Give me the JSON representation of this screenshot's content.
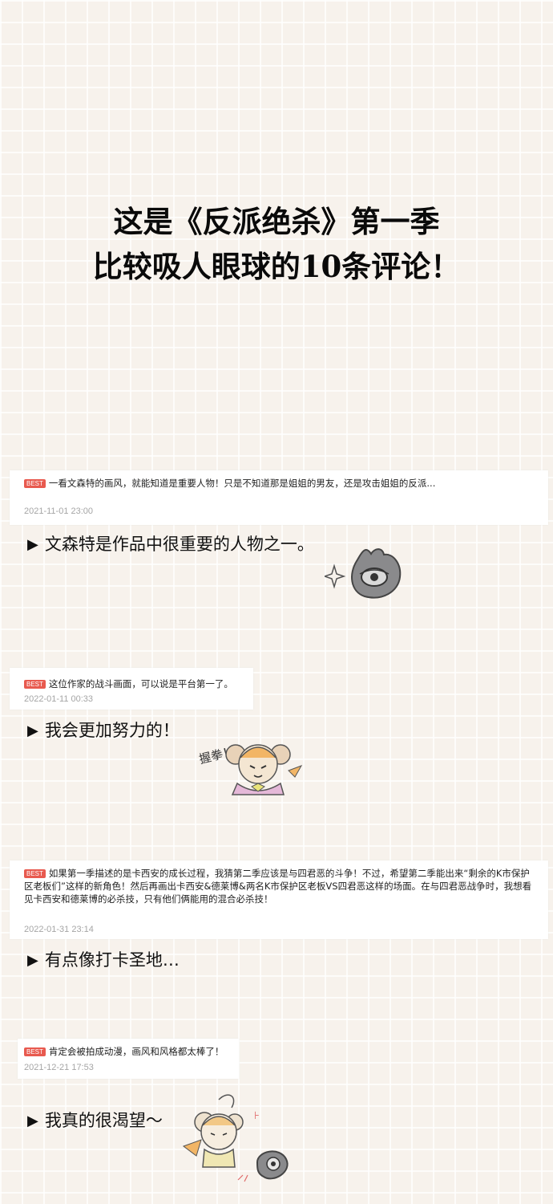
{
  "title": {
    "line1": "这是《反派绝杀》第一季",
    "line2": "比较吸人眼球的10条评论！"
  },
  "badge_label": "BEST",
  "comments": [
    {
      "text": "一看文森特的画风，就能知道是重要人物！只是不知道那是姐姐的男友，还是攻击姐姐的反派...",
      "date": "2021-11-01 23:00",
      "reply": "文森特是作品中很重要的人物之一。"
    },
    {
      "text": "这位作家的战斗画面，可以说是平台第一了。",
      "date": "2022-01-11 00:33",
      "reply": "我会更加努力的！"
    },
    {
      "text": "如果第一季描述的是卡西安的成长过程，我猜第二季应该是与四君恶的斗争！不过，希望第二季能出来“剩余的K市保护区老板们”这样的新角色！然后再画出卡西安&德莱博&两名K市保护区老板VS四君恶这样的场面。在与四君恶战争时，我想看见卡西安和德莱博的必杀技，只有他们俩能用的混合必杀技！",
      "date": "2022-01-31 23:14",
      "reply": "有点像打卡圣地…"
    },
    {
      "text": "肯定会被拍成动漫，画风和风格都太棒了！",
      "date": "2021-12-21 17:53",
      "reply": "我真的很渴望～"
    }
  ],
  "doodle_text": "握拳！",
  "arrow_glyph": "▶"
}
